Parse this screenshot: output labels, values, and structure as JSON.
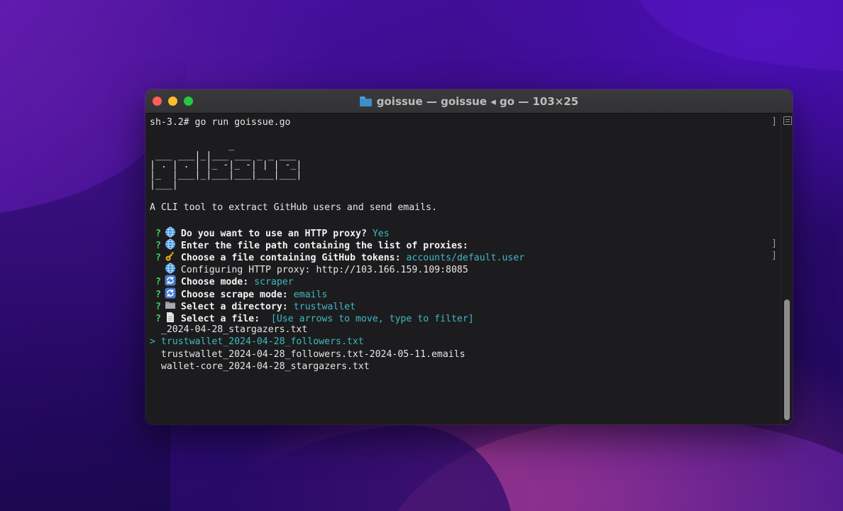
{
  "window": {
    "title": "goissue — goissue ◂ go — 103×25"
  },
  "terminal": {
    "prompt_line": "sh-3.2# go run goissue.go",
    "ascii_art": "              _\n ___ ___|_|___ ___ _ _ ___\n| . | . | |_ -|_ -| | | -_|\n|_  |___|_|___|___|___|___|\n|___|",
    "description": "A CLI tool to extract GitHub users and send emails.",
    "questions": [
      {
        "mark": "?",
        "icon": "globe-icon",
        "question": "Do you want to use an HTTP proxy?",
        "answer": "Yes"
      },
      {
        "mark": "?",
        "icon": "globe-icon",
        "question": "Enter the file path containing the list of proxies:",
        "answer": ""
      },
      {
        "mark": "?",
        "icon": "key-icon",
        "question": "Choose a file containing GitHub tokens:",
        "answer": "accounts/default.user"
      },
      {
        "mark": "",
        "icon": "globe-icon",
        "question": "Configuring HTTP proxy: http://103.166.159.109:8085",
        "answer": ""
      },
      {
        "mark": "?",
        "icon": "refresh-icon",
        "question": "Choose mode:",
        "answer": "scraper"
      },
      {
        "mark": "?",
        "icon": "refresh-icon",
        "question": "Choose scrape mode:",
        "answer": "emails"
      },
      {
        "mark": "?",
        "icon": "folder-icon",
        "question": "Select a directory:",
        "answer": "trustwallet"
      },
      {
        "mark": "?",
        "icon": "document-icon",
        "question": "Select a file:",
        "answer": " [Use arrows to move, type to filter]"
      }
    ],
    "files": [
      {
        "prefix": " ",
        "name": "_2024-04-28_stargazers.txt",
        "selected": false
      },
      {
        "prefix": ">",
        "name": "trustwallet_2024-04-28_followers.txt",
        "selected": true
      },
      {
        "prefix": " ",
        "name": "trustwallet_2024-04-28_followers.txt-2024-05-11.emails",
        "selected": false
      },
      {
        "prefix": " ",
        "name": "wallet-core_2024-04-28_stargazers.txt",
        "selected": false
      }
    ]
  },
  "colors": {
    "question_mark": "#42d15a",
    "answer": "#3fb9c2"
  }
}
